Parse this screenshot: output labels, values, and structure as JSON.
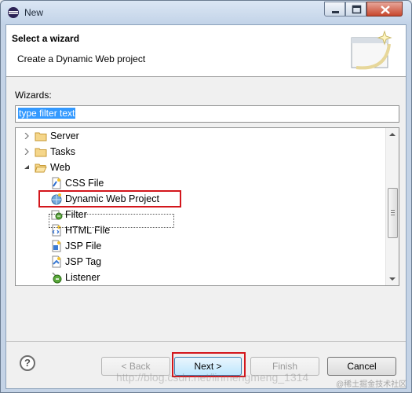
{
  "window": {
    "title": "New"
  },
  "header": {
    "title": "Select a wizard",
    "description": "Create a Dynamic Web project"
  },
  "wizards": {
    "label": "Wizards:",
    "filter_value": "type filter text",
    "tree": [
      {
        "label": "Server",
        "icon": "folder-icon",
        "expanded": false,
        "level": 0
      },
      {
        "label": "Tasks",
        "icon": "folder-icon",
        "expanded": false,
        "level": 0
      },
      {
        "label": "Web",
        "icon": "folder-open-icon",
        "expanded": true,
        "level": 0
      },
      {
        "label": "CSS File",
        "icon": "css-file-icon",
        "level": 1
      },
      {
        "label": "Dynamic Web Project",
        "icon": "web-project-icon",
        "level": 1,
        "selected": true
      },
      {
        "label": "Filter",
        "icon": "filter-icon",
        "level": 1
      },
      {
        "label": "HTML File",
        "icon": "html-file-icon",
        "level": 1
      },
      {
        "label": "JSP File",
        "icon": "jsp-file-icon",
        "level": 1
      },
      {
        "label": "JSP Tag",
        "icon": "jsp-tag-icon",
        "level": 1
      },
      {
        "label": "Listener",
        "icon": "listener-icon",
        "level": 1
      }
    ]
  },
  "buttons": {
    "back": "< Back",
    "next": "Next >",
    "finish": "Finish",
    "cancel": "Cancel",
    "help": "?"
  },
  "watermark": "http://blog.csdn.net/linmengmeng_1314",
  "watermark2": "@稀土掘金技术社区",
  "colors": {
    "accent_red": "#d3161c",
    "selection_blue": "#3399ff"
  }
}
